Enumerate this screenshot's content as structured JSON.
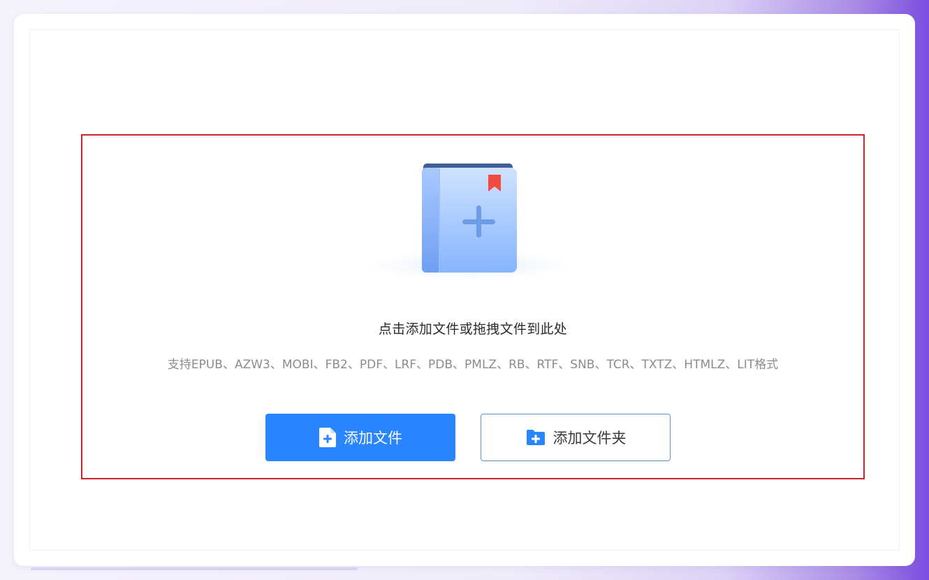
{
  "dropzone": {
    "hint": "点击添加文件或拖拽文件到此处",
    "formats": "支持EPUB、AZW3、MOBI、FB2、PDF、LRF、PDB、PMLZ、RB、RTF、SNB、TCR、TXTZ、HTMLZ、LIT格式"
  },
  "buttons": {
    "add_file": "添加文件",
    "add_folder": "添加文件夹"
  },
  "icons": {
    "illustration": "book-add-icon",
    "add_file": "file-plus-icon",
    "add_folder": "folder-plus-icon"
  },
  "colors": {
    "primary": "#2a86ff",
    "drop_zone_border": "#c9252d",
    "bookmark": "#f24b3d"
  }
}
